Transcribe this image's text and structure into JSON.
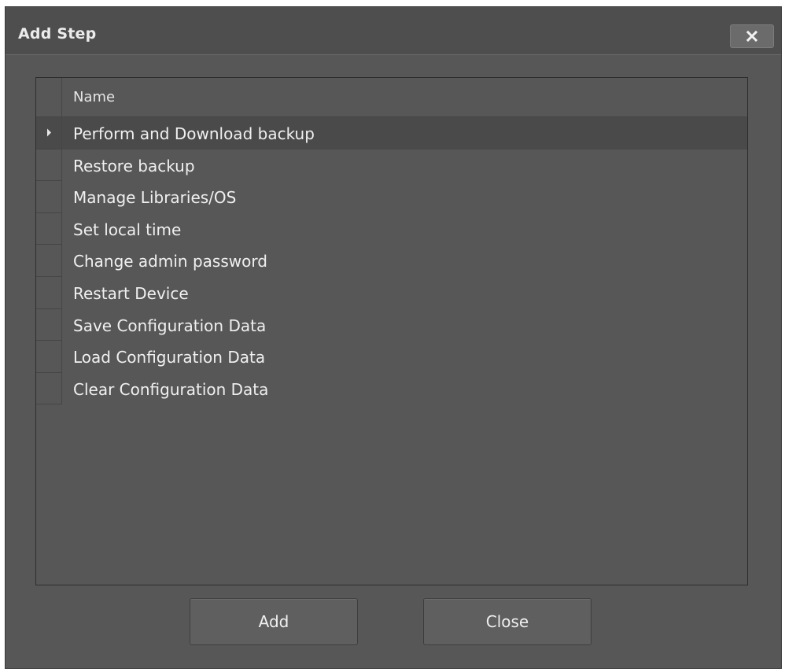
{
  "dialog": {
    "title": "Add Step",
    "close_icon": "close-x-icon"
  },
  "grid": {
    "column_header": "Name",
    "selected_index": 0,
    "selected_marker_icon": "row-pointer-icon",
    "rows": [
      "Perform and Download backup",
      "Restore backup",
      "Manage Libraries/OS",
      "Set local time",
      "Change admin password",
      "Restart Device",
      "Save Configuration Data",
      "Load Configuration Data",
      "Clear Configuration Data"
    ]
  },
  "footer": {
    "add_label": "Add",
    "close_label": "Close"
  },
  "colors": {
    "dialog_background": "#575757",
    "selected_row": "#4a4a4a",
    "text": "#f0f0f0"
  }
}
